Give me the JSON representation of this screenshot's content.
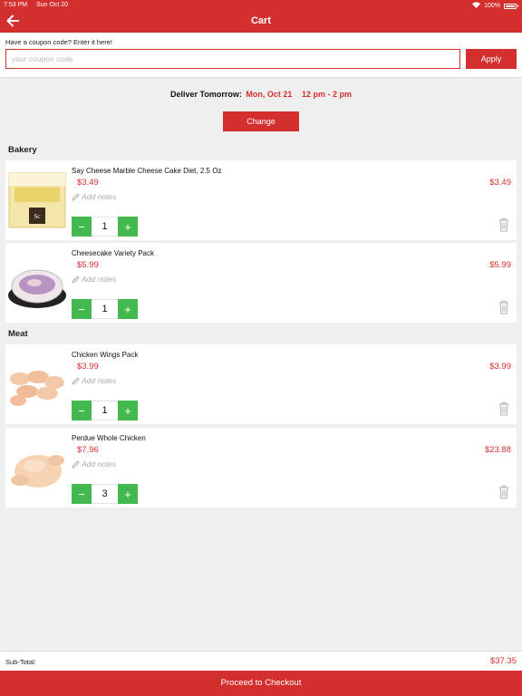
{
  "status_bar": {
    "time": "7:53 PM",
    "date": "Sun Oct 20",
    "battery": "100%"
  },
  "header": {
    "title": "Cart",
    "back_icon": "arrow-left-icon"
  },
  "coupon": {
    "label": "Have a coupon code? Enter it here!",
    "placeholder": "your coupon code",
    "value": "",
    "apply_label": "Apply"
  },
  "delivery": {
    "label": "Deliver Tomorrow:",
    "date": "Mon, Oct 21",
    "window": "12 pm - 2 pm",
    "change_label": "Change"
  },
  "sections": [
    {
      "title": "Bakery",
      "items": [
        {
          "name": "Say Cheese Marble Cheese Cake Diet, 2.5 Oz",
          "unit_price": "$3.49",
          "notes": "Add notes",
          "qty": "1",
          "total": "$3.49"
        },
        {
          "name": "Cheesecake Variety Pack",
          "unit_price": "$5.99",
          "notes": "Add notes",
          "qty": "1",
          "total": "$5.99"
        }
      ]
    },
    {
      "title": "Meat",
      "items": [
        {
          "name": "Chicken Wings Pack",
          "unit_price": "$3.99",
          "notes": "Add notes",
          "qty": "1",
          "total": "$3.99"
        },
        {
          "name": "Perdue Whole Chicken",
          "unit_price": "$7.96",
          "notes": "Add notes",
          "qty": "3",
          "total": "$23.88"
        }
      ]
    }
  ],
  "summary": {
    "subtotal_label": "Sub-Total:",
    "subtotal_value": "$37.35"
  },
  "checkout": {
    "label": "Proceed to Checkout"
  },
  "colors": {
    "brand": "#d32f2f",
    "stepper": "#43b84e"
  }
}
